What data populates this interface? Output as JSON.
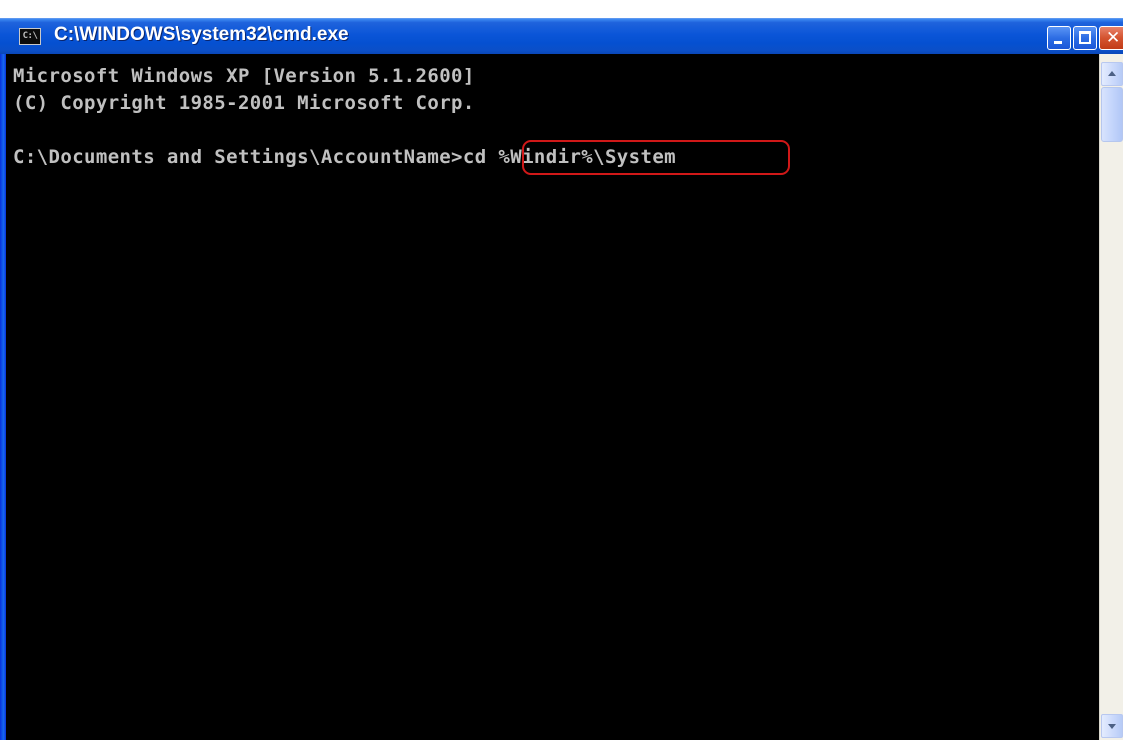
{
  "window": {
    "title": "C:\\WINDOWS\\system32\\cmd.exe",
    "icon_label": "C:\\"
  },
  "console": {
    "lines": [
      "Microsoft Windows XP [Version 5.1.2600]",
      "(C) Copyright 1985-2001 Microsoft Corp.",
      ""
    ],
    "prompt": "C:\\Documents and Settings\\AccountName>",
    "command": "cd %Windir%\\System"
  },
  "annotation": {
    "highlight_color": "#d01818",
    "highlighted_item": "console.command"
  },
  "colors": {
    "titlebar": "#0a55d8",
    "console_bg": "#000000",
    "console_text": "#c0c0c0",
    "close_button": "#d4532f"
  },
  "icons": {
    "app": "cmd-icon",
    "minimize": "minimize-icon",
    "maximize": "maximize-icon",
    "close": "close-icon",
    "scroll_up": "arrow-up-icon",
    "scroll_down": "arrow-down-icon"
  }
}
